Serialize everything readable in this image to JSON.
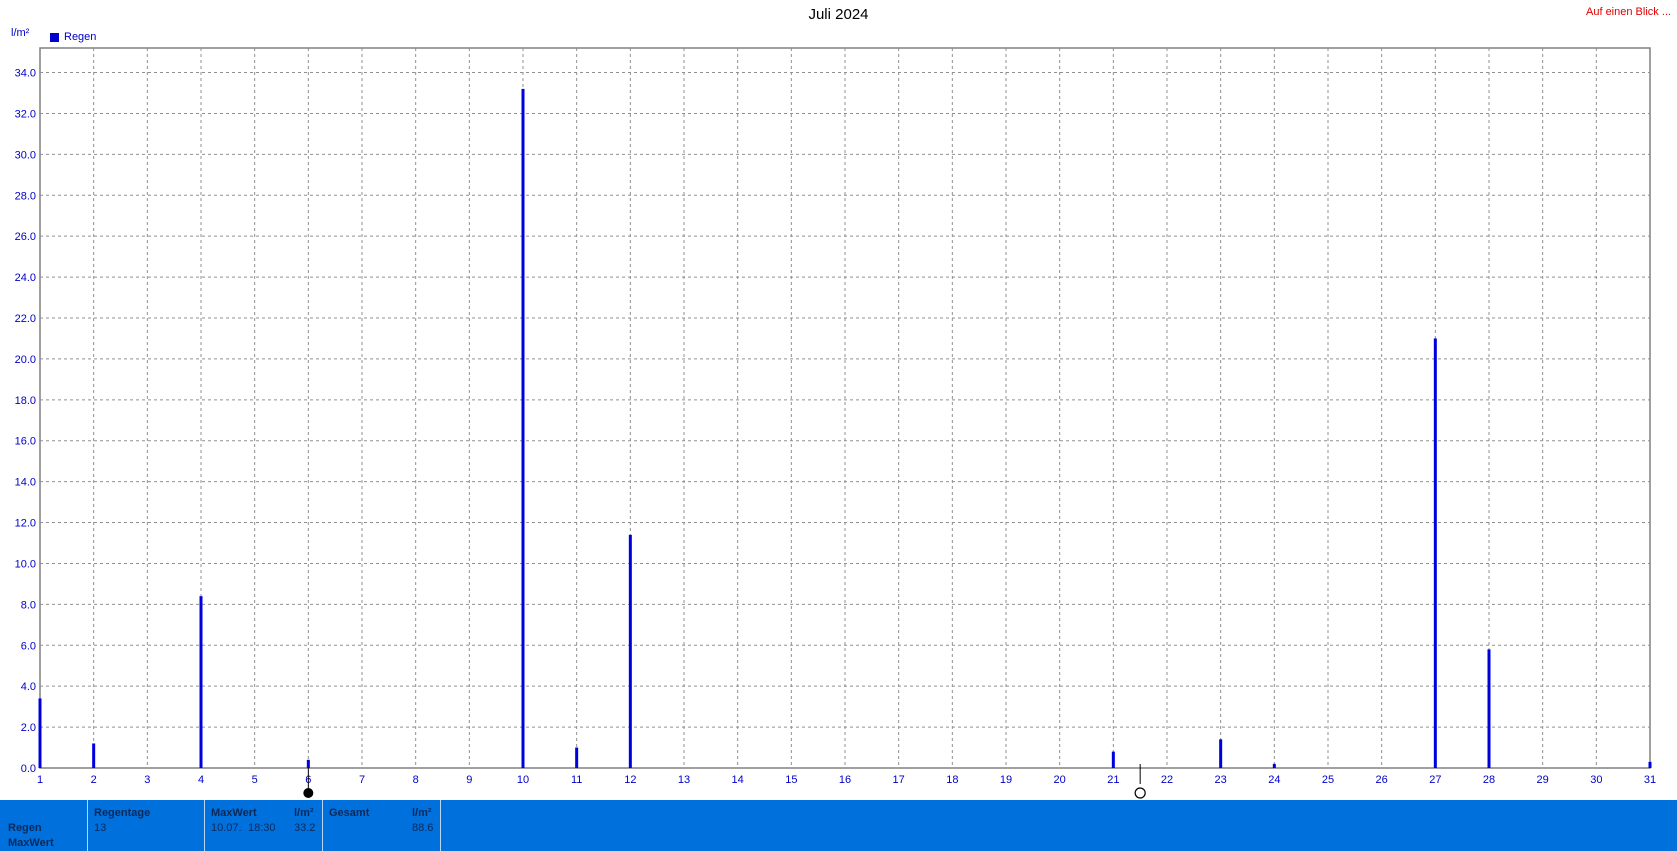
{
  "header": {
    "link": "Auf einen Blick ..."
  },
  "chart_data": {
    "type": "bar",
    "title": "Juli 2024",
    "ylabel": "l/m²",
    "xlabel": "",
    "xlim": [
      1,
      31
    ],
    "ylim": [
      0,
      35.2
    ],
    "yticks": [
      "0.0",
      "2.0",
      "4.0",
      "6.0",
      "8.0",
      "10.0",
      "12.0",
      "14.0",
      "16.0",
      "18.0",
      "20.0",
      "22.0",
      "24.0",
      "26.0",
      "28.0",
      "30.0",
      "32.0",
      "34.0"
    ],
    "xticks": [
      "1",
      "2",
      "3",
      "4",
      "5",
      "6",
      "7",
      "8",
      "9",
      "10",
      "11",
      "12",
      "13",
      "14",
      "15",
      "16",
      "17",
      "18",
      "19",
      "20",
      "21",
      "22",
      "23",
      "24",
      "25",
      "26",
      "27",
      "28",
      "29",
      "30",
      "31"
    ],
    "grid": true,
    "legend_position": "top-left",
    "series": [
      {
        "name": "Regen",
        "color": "#0000dd",
        "points": [
          {
            "x": 1,
            "y": 3.4
          },
          {
            "x": 2,
            "y": 1.2
          },
          {
            "x": 4,
            "y": 8.4
          },
          {
            "x": 6,
            "y": 0.4
          },
          {
            "x": 10,
            "y": 33.2
          },
          {
            "x": 11,
            "y": 1.0
          },
          {
            "x": 12,
            "y": 11.4
          },
          {
            "x": 21,
            "y": 0.8
          },
          {
            "x": 23,
            "y": 1.4
          },
          {
            "x": 24,
            "y": 0.2
          },
          {
            "x": 27,
            "y": 21.0
          },
          {
            "x": 28,
            "y": 5.8
          },
          {
            "x": 31,
            "y": 0.3
          }
        ]
      }
    ],
    "annotations": [
      {
        "type": "full-moon-marker",
        "x": 6
      },
      {
        "type": "new-moon-marker",
        "x": 21.5
      }
    ]
  },
  "stats": {
    "row_labels": [
      "Regen",
      "MaxWert"
    ],
    "regentage_label": "Regentage",
    "regentage_value": "13",
    "maxwert_label": "MaxWert",
    "maxwert_unit": "l/m²",
    "maxwert_date": "10.07.",
    "maxwert_time": "18:30",
    "maxwert_value": "33.2",
    "gesamt_label": "Gesamt",
    "gesamt_unit": "l/m²",
    "gesamt_value": "88.6"
  },
  "colors": {
    "bar": "#0000dd",
    "axis_text": "#0000cc",
    "stats_bg": "#0070dd",
    "link": "#e00000"
  }
}
